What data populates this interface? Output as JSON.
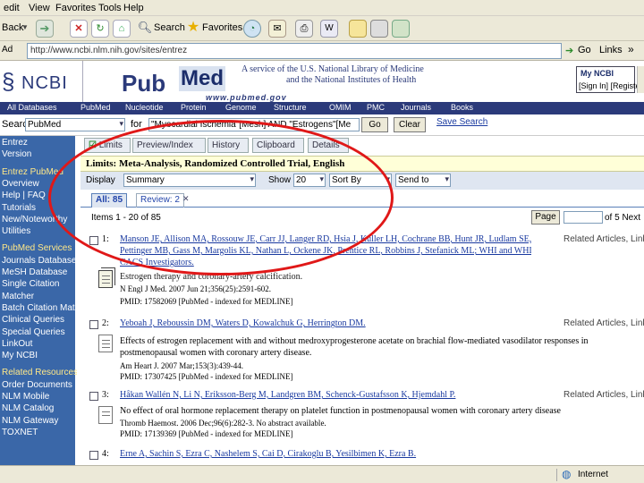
{
  "menu": [
    "edit",
    "View",
    "Favorites",
    "Tools",
    "Help"
  ],
  "toolbar": {
    "back": "Back",
    "search": "Search",
    "favorites": "Favorites"
  },
  "address": {
    "label": "Address",
    "url": "http://www.ncbi.nlm.nih.gov/sites/entrez",
    "go": "Go",
    "links": "Links"
  },
  "header": {
    "ncbi": "NCBI",
    "pub": "Pub",
    "med": "Med",
    "pubmed_url": "www.pubmed.gov",
    "service_line1": "A service of the U.S. National Library of Medicine",
    "service_line2": "and the National Institutes of Health",
    "my_ncbi": "My NCBI",
    "sign_in": "[Sign In] [Register]"
  },
  "nav": [
    "All Databases",
    "PubMed",
    "Nucleotide",
    "Protein",
    "Genome",
    "Structure",
    "OMIM",
    "PMC",
    "Journals",
    "Books"
  ],
  "search": {
    "label": "Search",
    "db": "PubMed",
    "for_label": "for",
    "query": "\"Myocardial Ischemia\"[Mesh] AND \"Estrogens\"[Me",
    "go": "Go",
    "clear": "Clear",
    "save": "Save Search"
  },
  "tabs": [
    "Limits",
    "Preview/Index",
    "History",
    "Clipboard",
    "Details"
  ],
  "limits_text": "Limits: Meta-Analysis, Randomized Controlled Trial, English",
  "display": {
    "label": "Display",
    "value": "Summary",
    "show_label": "Show",
    "show_value": "20",
    "sort_value": "Sort By",
    "send_value": "Send to"
  },
  "subtabs": {
    "all": "All: 85",
    "review": "Review: 2"
  },
  "items_text": "Items 1 - 20 of 85",
  "page_button": "Page",
  "page_of": "of 5 Next",
  "sidebar": [
    {
      "text": "Entrez",
      "head": false
    },
    {
      "text": "Version",
      "head": false
    },
    {
      "text": "Entrez PubMed",
      "head": true
    },
    {
      "text": "Overview",
      "head": false
    },
    {
      "text": "Help | FAQ",
      "head": false
    },
    {
      "text": "Tutorials",
      "head": false
    },
    {
      "text": "New/Noteworthy",
      "head": false
    },
    {
      "text": "Utilities",
      "head": false
    },
    {
      "text": "PubMed Services",
      "head": true
    },
    {
      "text": "Journals Database",
      "head": false
    },
    {
      "text": "MeSH Database",
      "head": false
    },
    {
      "text": "Single Citation",
      "head": false
    },
    {
      "text": "Matcher",
      "head": false
    },
    {
      "text": "Batch Citation Matcher",
      "head": false
    },
    {
      "text": "Clinical Queries",
      "head": false
    },
    {
      "text": "Special Queries",
      "head": false
    },
    {
      "text": "LinkOut",
      "head": false
    },
    {
      "text": "My NCBI",
      "head": false
    },
    {
      "text": "Related Resources",
      "head": true
    },
    {
      "text": "Order Documents",
      "head": false
    },
    {
      "text": "NLM Mobile",
      "head": false
    },
    {
      "text": "NLM Catalog",
      "head": false
    },
    {
      "text": "NLM Gateway",
      "head": false
    },
    {
      "text": "TOXNET",
      "head": false
    }
  ],
  "results": [
    {
      "num": "1:",
      "authors1": "Manson JE, Allison MA, Rossouw JE, Carr JJ, Langer RD, Hsia J, Kuller LH, Cochrane BB, Hunt JR, Ludlam SE,",
      "authors2": "Pettinger MB, Gass M, Margolis KL, Nathan L, Ockene JK, Prentice RL, Robbins J, Stefanick ML; WHI and WHI-",
      "authors3": "CACS Investigators.",
      "title": "Estrogen therapy and coronary-artery calcification.",
      "source": "N Engl J Med. 2007 Jun 21;356(25):2591-602.",
      "pmid": "PMID: 17582069 [PubMed - indexed for MEDLINE]",
      "related": "Related Articles, Links"
    },
    {
      "num": "2:",
      "authors1": "Yeboah J, Reboussin DM, Waters D, Kowalchuk G, Herrington DM.",
      "title": "Effects of estrogen replacement with and without medroxyprogesterone acetate on brachial flow-mediated vasodilator responses in",
      "title2": "postmenopausal women with coronary artery disease.",
      "source": "Am Heart J. 2007 Mar;153(3):439-44.",
      "pmid": "PMID: 17307425 [PubMed - indexed for MEDLINE]",
      "related": "Related Articles, Links"
    },
    {
      "num": "3:",
      "authors1": "Håkan Wallén N, Li N, Eriksson-Berg M, Landgren BM, Schenck-Gustafsson K, Hjemdahl P.",
      "title": "No effect of oral hormone replacement therapy on platelet function in postmenopausal women with coronary artery disease",
      "source": "Thromb Haemost. 2006 Dec;96(6):282-3. No abstract available.",
      "pmid": "PMID: 17139369 [PubMed - indexed for MEDLINE]",
      "related": "Related Articles, Links"
    },
    {
      "num": "4:",
      "authors1": "Erne A, Sachin S, Ezra C, Nashelem S, Cai D, Cirakoglu B, Yesilbimen K, Ezra B.",
      "related": ""
    }
  ],
  "status": {
    "zone": "Internet"
  }
}
